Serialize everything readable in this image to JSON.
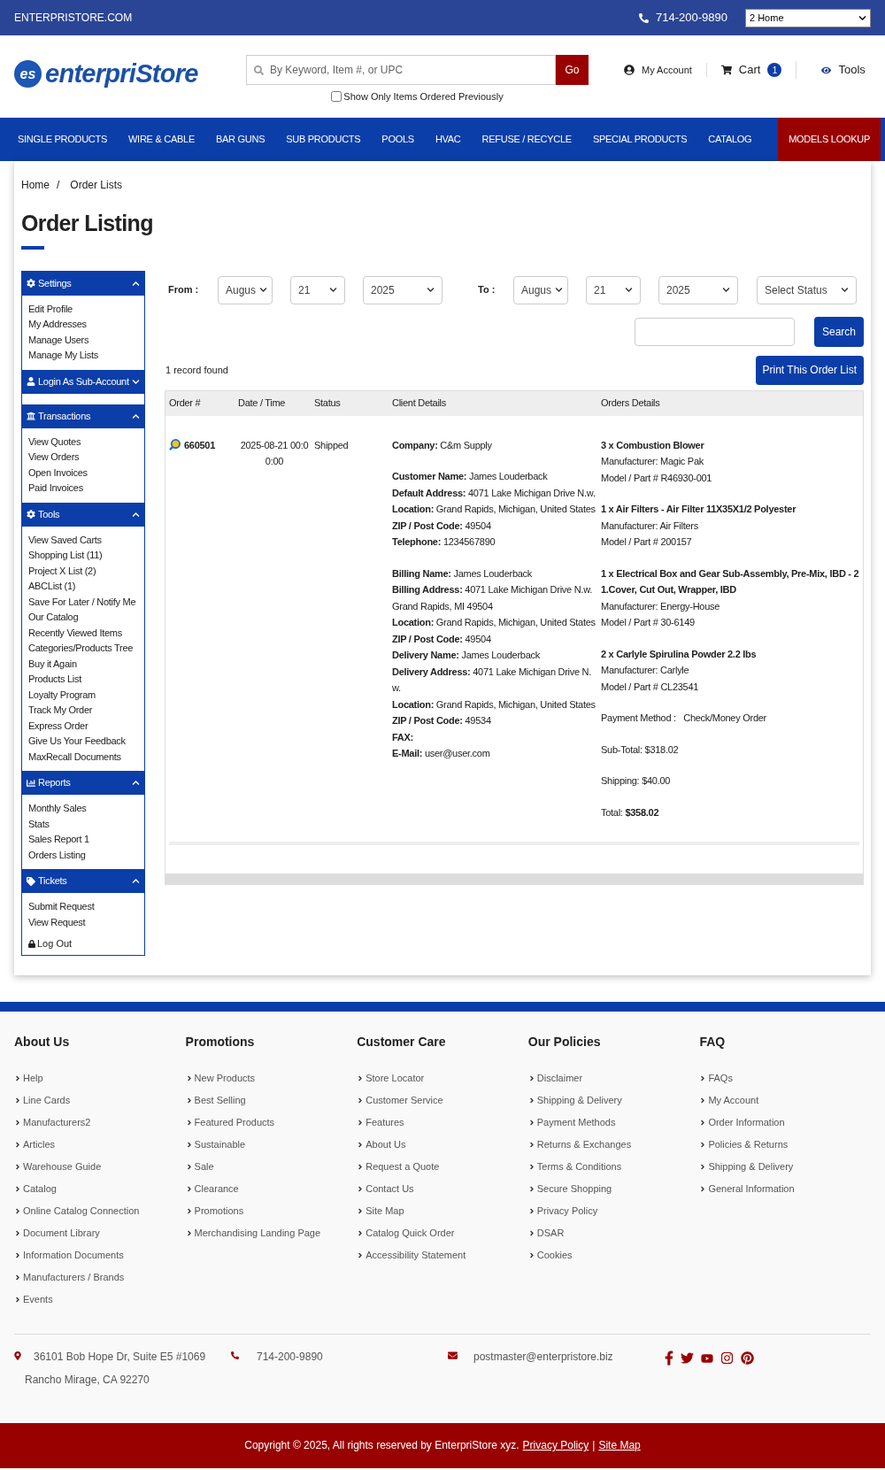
{
  "top_bar": {
    "site": "ENTERPRISTORE.COM",
    "phone": "714-200-9890",
    "store_select": "2 Home"
  },
  "header": {
    "logo_mark": "es",
    "logo_text": "enterpriStore",
    "search": {
      "placeholder": "By Keyword, Item #, or UPC",
      "button": "Go"
    },
    "filter": {
      "label": "Show Only Items Ordered Previously",
      "checked": false
    },
    "account": "My Account",
    "cart": "Cart",
    "cart_count": "1",
    "tools": "Tools"
  },
  "nav": [
    {
      "label": "SINGLE PRODUCTS",
      "selected": false
    },
    {
      "label": "WIRE & CABLE",
      "selected": false
    },
    {
      "label": "BAR GUNS",
      "selected": false
    },
    {
      "label": "SUB PRODUCTS",
      "selected": false
    },
    {
      "label": "POOLS",
      "selected": false
    },
    {
      "label": "HVAC",
      "selected": false
    },
    {
      "label": "REFUSE / RECYCLE",
      "selected": false
    },
    {
      "label": "SPECIAL PRODUCTS",
      "selected": false
    },
    {
      "label": "CATALOG",
      "selected": false
    },
    {
      "label": "MODELS LOOKUP",
      "selected": true
    }
  ],
  "breadcrumb": [
    "Home",
    "/",
    "Order Lists"
  ],
  "page_title": "Order Listing",
  "sidebar": {
    "sections": [
      {
        "title": "Settings",
        "expanded": true,
        "items": [
          "Edit Profile",
          "My Addresses",
          "Manage Users",
          "Manage My Lists"
        ]
      },
      {
        "title": "Login As Sub-Account",
        "expanded": false
      },
      {
        "title": "Transactions",
        "expanded": true,
        "items": [
          "View Quotes",
          "View Orders",
          "Open Invoices",
          "Paid Invoices"
        ]
      },
      {
        "title": "Tools",
        "expanded": true,
        "items": [
          "View Saved Carts",
          "Shopping List (11)",
          "Project X List (2)",
          "ABCList (1)",
          "Save For Later / Notify Me",
          "Our Catalog",
          "Recently Viewed Items",
          "Categories/Products Tree",
          "Buy it Again",
          "Products List",
          "Loyalty Program",
          "Track My Order",
          "Express Order",
          "Give Us Your Feedback",
          "MaxRecall Documents"
        ]
      },
      {
        "title": "Reports",
        "expanded": true,
        "items": [
          "Monthly Sales",
          "Stats",
          "Sales Report 1",
          "Orders Listing"
        ]
      },
      {
        "title": "Tickets",
        "expanded": true,
        "items": [
          "Submit Request",
          "View Request"
        ]
      }
    ],
    "logout": "Log Out"
  },
  "filters": {
    "from_label": "From :",
    "from": [
      "Augus",
      "21",
      "2025"
    ],
    "to_label": "To :",
    "to": [
      "Augus",
      "21",
      "2025"
    ],
    "status": "Select Status",
    "search_button": "Search",
    "print_button": "Print This Order List"
  },
  "record_count": "1 record found",
  "table": {
    "columns": [
      "Order #",
      "Date / Time",
      "Status",
      "Client Details",
      "Orders Details"
    ],
    "rows": [
      {
        "order": "660501",
        "date": "2025-08-21 00:00:00",
        "status": "Shipped",
        "client": [
          [
            "**Company:** C&m Supply"
          ],
          [
            "**Customer Name:** James Louderback",
            "**Default Address:** 4071 Lake Michigan Drive N.w.",
            "**Location:** Grand Rapids, Michigan, United States",
            "**ZIP / Post Code:** 49504",
            "**Telephone:** 1234567890"
          ],
          [
            "**Billing Name:** James Louderback",
            "**Billing Address:** 4071 Lake Michigan Drive N.w. Grand Rapids, MI 49504",
            "**Location:** Grand Rapids, Michigan, United States",
            "**ZIP / Post Code:** 49504",
            "**Delivery Name:** James Louderback",
            "**Delivery Address:** 4071 Lake Michigan Drive N.w.",
            "**Location:** Grand Rapids, Michigan, United States",
            "**ZIP / Post Code:** 49534",
            "**FAX:**",
            "**E-Mail:** user@user.com"
          ]
        ],
        "items": [
          {
            "title": "3 x Combustion Blower",
            "manufacturer": "Manufacturer: Magic Pak",
            "model": "Model / Part # R46930-001"
          },
          {
            "title": "1 x Air Filters - Air Filter 11X35X1/2 Polyester",
            "manufacturer": "Manufacturer: Air Filters",
            "model": "Model / Part # 200157"
          },
          {
            "title": "1 x Electrical Box and Gear Sub-Assembly, Pre-Mix, IBD - 21.Cover, Cut Out, Wrapper, IBD",
            "manufacturer": "Manufacturer: Energy-House",
            "model": "Model / Part # 30-6149"
          },
          {
            "title": "2 x Carlyle Spirulina Powder 2.2 lbs",
            "manufacturer": "Manufacturer: Carlyle",
            "model": "Model / Part # CL23541"
          }
        ],
        "payment": "Payment Method :   Check/Money Order",
        "subtotal": "Sub-Total: $318.02",
        "shipping": "Shipping: $40.00",
        "total": "Total: **$358.02**"
      }
    ]
  },
  "footer": {
    "columns": [
      {
        "title": "About Us",
        "links": [
          "Help",
          "Line Cards",
          "Manufacturers2",
          "Articles",
          "Warehouse Guide",
          "Catalog",
          "Online Catalog Connection",
          "Document Library",
          "Information Documents",
          "Manufacturers / Brands",
          "Events"
        ]
      },
      {
        "title": "Promotions",
        "links": [
          "New Products",
          "Best Selling",
          "Featured Products",
          "Sustainable",
          "Sale",
          "Clearance",
          "Promotions",
          "Merchandising Landing Page"
        ]
      },
      {
        "title": "Customer Care",
        "links": [
          "Store Locator",
          "Customer Service",
          "Features",
          "About Us",
          "Request a Quote",
          "Contact Us",
          "Site Map",
          "Catalog Quick Order",
          "Accessibility Statement"
        ]
      },
      {
        "title": "Our Policies",
        "links": [
          "Disclaimer",
          "Shipping & Delivery",
          "Payment Methods",
          "Returns & Exchanges",
          "Terms & Conditions",
          "Secure Shopping",
          "Privacy Policy",
          "DSAR",
          "Cookies"
        ]
      },
      {
        "title": "FAQ",
        "links": [
          "FAQs",
          "My Account",
          "Order Information",
          "Policies & Returns",
          "Shipping & Delivery",
          "General Information"
        ]
      }
    ],
    "address": [
      "36101 Bob Hope Dr, Suite E5 #1069",
      "Rancho Mirage, CA 92270"
    ],
    "phone": "714-200-9890",
    "email": "postmaster@enterpristore.biz"
  },
  "copyright": {
    "text": "Copyright © 2025, All rights reserved by EnterpriStore xyz.",
    "links": [
      "Privacy Policy",
      "Site Map"
    ],
    "separator": "|"
  }
}
